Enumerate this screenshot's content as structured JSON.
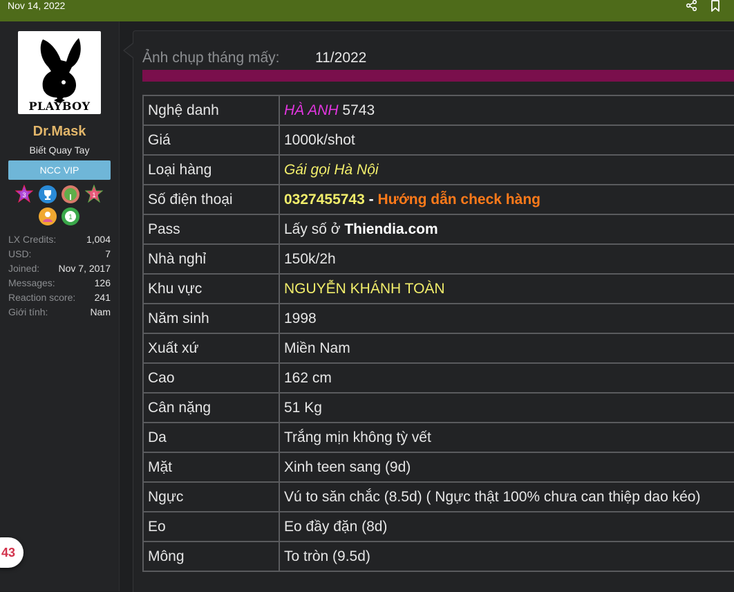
{
  "topbar": {
    "date": "Nov 14, 2022",
    "icons": [
      "share-icon",
      "bookmark-icon"
    ]
  },
  "user": {
    "avatar_logo_text": "PLAYBOY",
    "name": "Dr.Mask",
    "title": "Biết Quay Tay",
    "banner": "NCC VIP",
    "trophy_badges": [
      "3",
      "",
      "",
      "1",
      "",
      "1"
    ],
    "stats": [
      {
        "key": "LX Credits:",
        "value": "1,004"
      },
      {
        "key": "USD:",
        "value": "7"
      },
      {
        "key": "Joined:",
        "value": "Nov 7, 2017"
      },
      {
        "key": "Messages:",
        "value": "126"
      },
      {
        "key": "Reaction score:",
        "value": "241"
      },
      {
        "key": "Giới tính:",
        "value": "Nam"
      }
    ]
  },
  "floating_counter": "43",
  "post": {
    "photo_label": "Ảnh chụp tháng mấy:",
    "photo_value": "11/2022",
    "rows": {
      "stage_name": {
        "label": "Nghệ danh",
        "name": "HÀ ANH",
        "code": " 5743"
      },
      "price": {
        "label": "Giá",
        "value": "1000k/shot"
      },
      "category": {
        "label": "Loại hàng",
        "value": "Gái gọi Hà Nội"
      },
      "phone": {
        "label": "Số điện thoại",
        "number": "0327455743",
        "sep": " - ",
        "link": "Hướng dẫn check hàng"
      },
      "pass": {
        "label": "Pass",
        "prefix": "Lấy số ở ",
        "site": "Thiendia.com"
      },
      "motel": {
        "label": "Nhà nghỉ",
        "value": "150k/2h"
      },
      "area": {
        "label": "Khu vực",
        "value": "NGUYỄN KHÁNH TOÀN"
      },
      "birth_year": {
        "label": "Năm sinh",
        "value": "1998"
      },
      "origin": {
        "label": "Xuất xứ",
        "value": "Miền Nam"
      },
      "height": {
        "label": "Cao",
        "value": "162 cm"
      },
      "weight": {
        "label": "Cân nặng",
        "value": "51 Kg"
      },
      "skin": {
        "label": "Da",
        "value": "Trắng mịn không tỳ vết"
      },
      "face": {
        "label": "Mặt",
        "value": "Xinh teen sang (9d)"
      },
      "chest": {
        "label": "Ngực",
        "value": "Vú to săn chắc (8.5d) ( Ngực thật 100% chưa can thiệp dao kéo)"
      },
      "waist": {
        "label": "Eo",
        "value": "Eo đầy đặn (8d)"
      },
      "butt": {
        "label": "Mông",
        "value": "To tròn (9.5d)"
      }
    }
  },
  "colors": {
    "topbar": "#4e6b1a",
    "purple_bar": "#7a0f4c",
    "name_pink": "#e236e0",
    "highlight_yellow": "#f2ee6b",
    "link_orange": "#ff7a1a",
    "username": "#e2b66a",
    "banner": "#6fb6d8"
  }
}
